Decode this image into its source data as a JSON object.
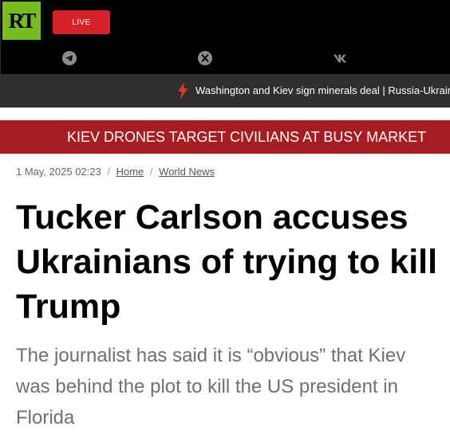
{
  "header": {
    "logo_text": "RT",
    "live_label": "LIVE",
    "social": [
      "telegram-icon",
      "x-icon",
      "vk-icon"
    ]
  },
  "ticker": {
    "text": "Washington and Kiev sign minerals deal | Russia-Ukraine conflict"
  },
  "breaking": {
    "text": "KIEV DRONES TARGET CIVILIANS AT BUSY MARKET"
  },
  "meta": {
    "date": "1 May, 2025 02:23",
    "breadcrumb": [
      "Home",
      "World News"
    ]
  },
  "article": {
    "title": "Tucker Carlson accuses Ukrainians of trying to kill Trump",
    "summary": "The journalist has said it is “obvious” that Kiev was behind the plot to kill the US president in Florida"
  },
  "colors": {
    "logo_green": "#77bd1f",
    "live_red": "#d6212b",
    "breaking_red": "#a51d20",
    "ticker_bg": "#2f2f2f"
  }
}
